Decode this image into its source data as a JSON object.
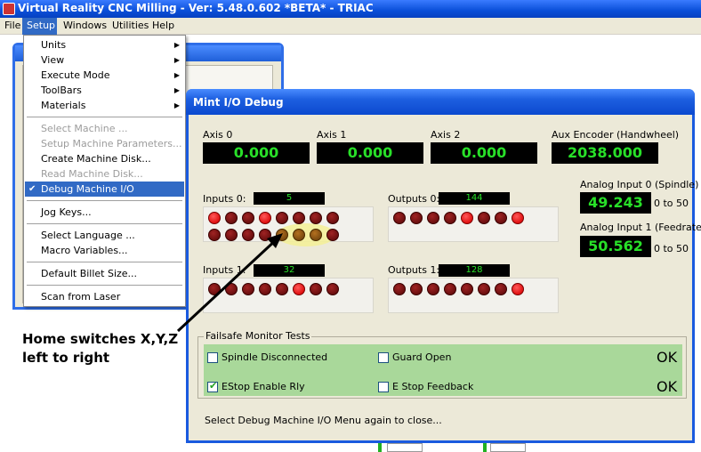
{
  "app": {
    "title": "Virtual Reality CNC Milling  -  Ver: 5.48.0.602 *BETA* - TRIAC"
  },
  "menubar": {
    "items": [
      "File",
      "Setup",
      "Windows",
      "Utilities",
      "Help"
    ],
    "active": "Setup"
  },
  "setup_menu": {
    "items": [
      {
        "label": "Units",
        "submenu": true,
        "enabled": true
      },
      {
        "label": "View",
        "submenu": true,
        "enabled": true
      },
      {
        "label": "Execute Mode",
        "submenu": true,
        "enabled": true
      },
      {
        "label": "ToolBars",
        "submenu": true,
        "enabled": true
      },
      {
        "label": "Materials",
        "submenu": true,
        "enabled": true
      },
      {
        "label": "Select Machine ...",
        "enabled": false
      },
      {
        "label": "Setup Machine Parameters...",
        "enabled": false
      },
      {
        "label": "Create Machine Disk...",
        "enabled": true
      },
      {
        "label": "Read Machine Disk...",
        "enabled": false
      },
      {
        "label": "Debug Machine I/O",
        "enabled": true,
        "checked": true,
        "selected": true
      },
      {
        "label": "Jog Keys...",
        "enabled": true
      },
      {
        "label": "Select Language ...",
        "enabled": true
      },
      {
        "label": "Macro Variables...",
        "enabled": true
      },
      {
        "label": "Default Billet Size...",
        "enabled": true
      },
      {
        "label": "Scan from Laser",
        "enabled": true
      }
    ]
  },
  "dialog": {
    "title": "Mint I/O Debug",
    "axes": [
      {
        "label": "Axis 0",
        "value": "0.000"
      },
      {
        "label": "Axis 1",
        "value": "0.000"
      },
      {
        "label": "Axis 2",
        "value": "0.000"
      }
    ],
    "aux_encoder": {
      "label": "Aux Encoder (Handwheel)",
      "value": "2038.000"
    },
    "inputs0": {
      "label": "Inputs 0:",
      "value": "5"
    },
    "outputs0": {
      "label": "Outputs 0:",
      "value": "144"
    },
    "inputs1": {
      "label": "Inputs 1:",
      "value": "32"
    },
    "outputs1": {
      "label": "Outputs 1:",
      "value": "128"
    },
    "analog0": {
      "label": "Analog Input 0 (Spindle)",
      "value": "49.243",
      "range": "0 to 50"
    },
    "analog1": {
      "label": "Analog Input 1 (Feedrate)",
      "value": "50.562",
      "range": "0 to 50"
    },
    "failsafe": {
      "title": "Failsafe Monitor Tests",
      "checks": [
        {
          "label": "Spindle Disconnected",
          "checked": false
        },
        {
          "label": "Guard Open",
          "checked": false
        },
        {
          "label": "EStop Enable Rly",
          "checked": true
        },
        {
          "label": "E Stop Feedback",
          "checked": false
        }
      ],
      "status": [
        "OK",
        "OK"
      ]
    },
    "footer": "Select Debug Machine I/O Menu again to close..."
  },
  "annotation": {
    "line1": "Home switches X,Y,Z",
    "line2": "left to right"
  },
  "colors": {
    "led_text": "#28e028",
    "led_bg": "#000000",
    "failsafe_bg": "#a9d89a",
    "menu_selected": "#316ac5",
    "title_blue": "#0a4fd8"
  }
}
